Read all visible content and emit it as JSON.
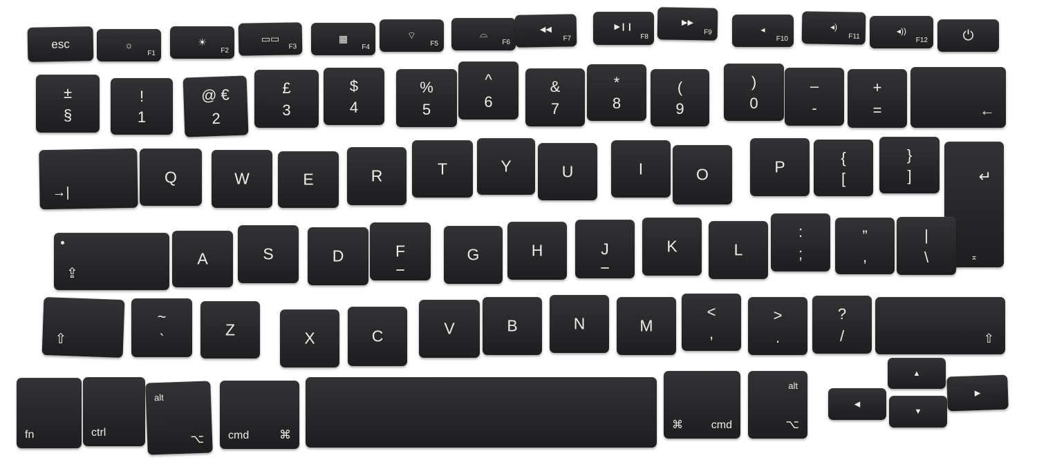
{
  "image": {
    "description_free": true
  },
  "colors": {
    "key": "#2a2a2c",
    "legend": "#ededed",
    "background": "#ffffff"
  },
  "fn_row": [
    {
      "id": "esc",
      "main": "esc"
    },
    {
      "id": "f1",
      "icon": "☼",
      "label": "F1"
    },
    {
      "id": "f2",
      "icon": "☀",
      "label": "F2"
    },
    {
      "id": "f3",
      "icon": "▭▭",
      "label": "F3"
    },
    {
      "id": "f4",
      "icon": "▦",
      "label": "F4"
    },
    {
      "id": "f5",
      "icon": "⌔",
      "label": "F5"
    },
    {
      "id": "f6",
      "icon": "⌓",
      "label": "F6"
    },
    {
      "id": "f7",
      "icon": "◀◀",
      "label": "F7"
    },
    {
      "id": "f8",
      "icon": "▶❙❙",
      "label": "F8"
    },
    {
      "id": "f9",
      "icon": "▶▶",
      "label": "F9"
    },
    {
      "id": "f10",
      "icon": "◂",
      "label": "F10"
    },
    {
      "id": "f11",
      "icon": "◂)",
      "label": "F11"
    },
    {
      "id": "f12",
      "icon": "◂))",
      "label": "F12"
    },
    {
      "id": "power",
      "icon": "⏻"
    }
  ],
  "num_row": [
    {
      "top": "±",
      "bot": "§"
    },
    {
      "top": "!",
      "bot": "1"
    },
    {
      "top": "@ €",
      "bot": "2"
    },
    {
      "top": "£",
      "bot": "3"
    },
    {
      "top": "$",
      "bot": "4"
    },
    {
      "top": "%",
      "bot": "5"
    },
    {
      "top": "^",
      "bot": "6"
    },
    {
      "top": "&",
      "bot": "7"
    },
    {
      "top": "*",
      "bot": "8"
    },
    {
      "top": "(",
      "bot": "9"
    },
    {
      "top": ")",
      "bot": "0"
    },
    {
      "top": "–",
      "bot": "-"
    },
    {
      "top": "+",
      "bot": "="
    },
    {
      "icon": "←"
    }
  ],
  "q_row": [
    {
      "icon": "→|"
    },
    {
      "main": "Q"
    },
    {
      "main": "W"
    },
    {
      "main": "E"
    },
    {
      "main": "R"
    },
    {
      "main": "T"
    },
    {
      "main": "Y"
    },
    {
      "main": "U"
    },
    {
      "main": "I"
    },
    {
      "main": "O"
    },
    {
      "main": "P"
    },
    {
      "top": "{",
      "bot": "["
    },
    {
      "top": "}",
      "bot": "]"
    },
    {
      "icon": "↵"
    }
  ],
  "a_row": [
    {
      "icon": "⇪"
    },
    {
      "main": "A"
    },
    {
      "main": "S"
    },
    {
      "main": "D"
    },
    {
      "main": "F"
    },
    {
      "main": "G"
    },
    {
      "main": "H"
    },
    {
      "main": "J"
    },
    {
      "main": "K"
    },
    {
      "main": "L"
    },
    {
      "top": ":",
      "bot": ";"
    },
    {
      "top": "”",
      "bot": ","
    },
    {
      "top": "|",
      "bot": "\\"
    },
    {
      "icon": "⌅"
    }
  ],
  "z_row": [
    {
      "icon": "⇧"
    },
    {
      "top": "~",
      "bot": "`"
    },
    {
      "main": "Z"
    },
    {
      "main": "X"
    },
    {
      "main": "C"
    },
    {
      "main": "V"
    },
    {
      "main": "B"
    },
    {
      "main": "N"
    },
    {
      "main": "M"
    },
    {
      "top": "<",
      "bot": ","
    },
    {
      "top": ">",
      "bot": "."
    },
    {
      "top": "?",
      "bot": "/"
    },
    {
      "icon": "⇧"
    }
  ],
  "bottom_row": [
    {
      "label": "fn"
    },
    {
      "label": "ctrl"
    },
    {
      "top": "alt",
      "icon": "⌥"
    },
    {
      "label": "cmd",
      "icon": "⌘"
    },
    {
      "space": ""
    },
    {
      "label": "cmd",
      "icon": "⌘"
    },
    {
      "top": "alt",
      "icon": "⌥"
    },
    {
      "arrow": "◀"
    },
    {
      "arrow": "▲"
    },
    {
      "arrow": "▼"
    },
    {
      "arrow": "▶"
    }
  ]
}
